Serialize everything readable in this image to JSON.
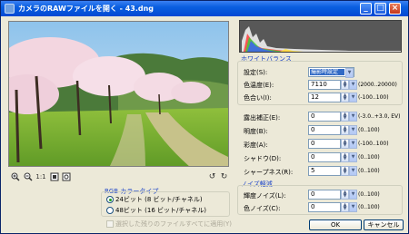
{
  "window": {
    "title": "カメラのRAWファイルを開く - 43.dng",
    "buttons": {
      "minimize": "_",
      "maximize": "□",
      "close": "×"
    }
  },
  "toolbar": {
    "zoom_in_icon": "magnifier-plus-icon",
    "zoom_out_icon": "magnifier-minus-icon",
    "actual_size": "1:1",
    "fit_icon": "fit-window-icon",
    "fullscreen_icon": "full-screen-icon",
    "rotate_left": "↺",
    "rotate_right": "↻"
  },
  "rgb_color_type": {
    "title": "RGB カラータイプ",
    "options": [
      {
        "label": "24ビット (8 ビット/チャネル)",
        "selected": true
      },
      {
        "label": "48ビット (16 ビット/チャネル)",
        "selected": false
      }
    ],
    "apply_all": "選択した残りのファイルすべてに適用(Y)"
  },
  "white_balance": {
    "title": "ホワイトバランス",
    "setting": {
      "label": "設定(S):",
      "value": "撮影時設定"
    },
    "color_temp": {
      "label": "色温度(E):",
      "value": "7110",
      "range": "(2000..20000)"
    },
    "tint": {
      "label": "色合い(I):",
      "value": "12",
      "range": "(-100..100)"
    }
  },
  "adjustments": [
    {
      "label": "露出補正(E):",
      "value": "0",
      "range": "(-3.0..+3.0, EV)"
    },
    {
      "label": "明度(B):",
      "value": "0",
      "range": "(0..100)"
    },
    {
      "label": "彩度(A):",
      "value": "0",
      "range": "(-100..100)"
    },
    {
      "label": "シャドウ(D):",
      "value": "0",
      "range": "(0..100)"
    },
    {
      "label": "シャープネス(R):",
      "value": "5",
      "range": "(0..100)"
    }
  ],
  "noise_reduction": {
    "title": "ノイズ軽減",
    "items": [
      {
        "label": "輝度ノイズ(L):",
        "value": "0",
        "range": "(0..100)"
      },
      {
        "label": "色ノイズ(C):",
        "value": "0",
        "range": "(0..100)"
      }
    ]
  },
  "actions": {
    "ok": "OK",
    "cancel": "キャンセル"
  },
  "colors": {
    "titlebar": "#0a5fe0",
    "group_title": "#1c44c8",
    "window_bg": "#ece9d8"
  }
}
